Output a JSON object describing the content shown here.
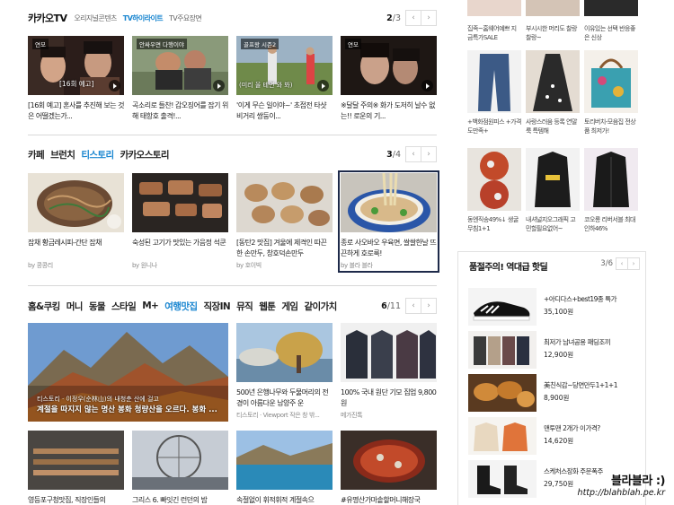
{
  "kakaotv": {
    "title": "카카오TV",
    "tabs": [
      "오리지널콘텐츠",
      "TV하이라이트",
      "TV주요장면"
    ],
    "active_tab": 1,
    "page": "2",
    "total": "/3",
    "cards": [
      {
        "badge": "연모",
        "caption": "[16회 예고] 혼사를 추진해 보는 것은 어떨겠는가..."
      },
      {
        "badge": "안싸우면 다행이야",
        "caption": "곡소리로 들찬! 갑오징어를 잡기 위해 태항호 출격!..."
      },
      {
        "badge": "골프왕 시즌2",
        "caption": "'이게 무슨 일이야~' 초접전 타샷 비거리 쌍둥이..."
      },
      {
        "badge": "연모",
        "caption": "※달달 주의※ 화가 도저히 날수 없는!! 로운의 기..."
      }
    ],
    "overlays": [
      "[16회 예고]",
      "(미리 올 테면 와 봐)"
    ]
  },
  "cafe": {
    "cats": [
      "카페",
      "브런치",
      "티스토리",
      "카카오스토리"
    ],
    "active_cat": 2,
    "page": "3",
    "total": "/4",
    "cards": [
      {
        "caption": "잡채 황금레시피-간단 잡채",
        "src": "by 콩콩리"
      },
      {
        "caption": "숙성된 고기가 맛있는 가음정 석쿤",
        "src": "by 원니나"
      },
      {
        "caption": "[동탄2 맛집] 겨울에 제격인 따끈한 손만두, 창호덕손만두",
        "src": "by 호이빅"
      },
      {
        "caption": "종로 사오바오 우육면, 쌀쌀한날 뜨끈하게 호로룩!",
        "src": "by 블라 블라"
      }
    ]
  },
  "home": {
    "cats": [
      "홈&쿠킹",
      "머니",
      "동물",
      "스타일",
      "M+",
      "여행맛집",
      "직장IN",
      "뮤직",
      "웹툰",
      "게임",
      "같이가치"
    ],
    "active_cat": 5,
    "page": "6",
    "total": "/11",
    "feature": {
      "line1": "티스토리 · 이정우(순林山)의 내청춘 산에 걸고",
      "line2": "계절을 따지지 않는 명산 봉화 청량산을 오르다. 봉화 ..."
    },
    "cards": [
      {
        "caption": "500년 은행나무와 두물머리의 전경이 아름다운 남양주 운",
        "src": "티스토리 · Viewport 작은 창 밖..."
      },
      {
        "caption": "100% 국내 원단 기모 집업 9,800원",
        "src": "메가진톡"
      }
    ],
    "row2": [
      "영등포구청맛집, 직장인들의",
      "그리스 6. 빠잇긴 런던의 밤",
      "속절없이 휘적휘적 계절속으",
      "#유명산가마솥할머니해장국"
    ]
  },
  "side_grid": [
    {
      "text": "집족~홈웨어예쁘 지금특가SALE"
    },
    {
      "text": "부시시한 머리도 찰랑찰랑~"
    },
    {
      "text": "이유있는 선택 반응좋은 신상"
    },
    {
      "text": "+백화점원피스 +가격도만족+"
    },
    {
      "text": "사랑스러움 등록 연말룩 특템해"
    },
    {
      "text": "토리버치-모음집 전상품 최저가!"
    },
    {
      "text": "동엔직송49%↓ 생굴무침1+1"
    },
    {
      "text": "내셔널지오그래픽 고민할필요없어~"
    },
    {
      "text": "코오롱 리버서블 최대인하46%"
    }
  ],
  "deals": {
    "title": "품절주의! 역대급 핫딜",
    "page": "3",
    "total": "/6",
    "items": [
      {
        "name": "+아디다스+best19종 특가",
        "price": "35,100원"
      },
      {
        "name": "최저가 남녀공용 패딩조끼",
        "price": "12,900원"
      },
      {
        "name": "美친식감~당면만두1+1+1",
        "price": "8,900원"
      },
      {
        "name": "맨투맨 2개가 이가격?",
        "price": "14,620원"
      },
      {
        "name": "스케처스장화 주문폭주",
        "price": "29,750원"
      }
    ]
  },
  "watermark": {
    "line1": "블라블라 :)",
    "line2": "http://blahblah.pe.kr"
  },
  "icons": {
    "prev": "‹",
    "next": "›"
  }
}
